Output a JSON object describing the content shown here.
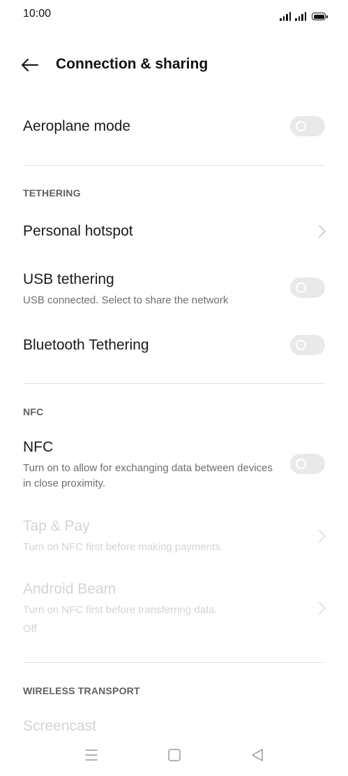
{
  "status_bar": {
    "time": "10:00"
  },
  "header": {
    "title": "Connection & sharing"
  },
  "settings": {
    "aeroplane_mode": {
      "title": "Aeroplane mode",
      "on": false
    },
    "tethering_header": "TETHERING",
    "personal_hotspot": {
      "title": "Personal hotspot"
    },
    "usb_tethering": {
      "title": "USB tethering",
      "subtitle": "USB connected. Select to share the network",
      "on": false
    },
    "bluetooth_tethering": {
      "title": "Bluetooth Tethering",
      "on": false
    },
    "nfc_header": "NFC",
    "nfc": {
      "title": "NFC",
      "subtitle": "Turn on to allow for exchanging data between devices in close proximity.",
      "on": false
    },
    "tap_pay": {
      "title": "Tap & Pay",
      "subtitle": "Turn on NFC first before making payments."
    },
    "android_beam": {
      "title": "Android Beam",
      "subtitle": "Turn on NFC first before transferring data.",
      "status": "Off"
    },
    "wireless_header": "WIRELESS TRANSPORT",
    "screencast": {
      "title": "Screencast"
    }
  },
  "colors": {
    "toggle_off": "#e9e9e9",
    "disabled_text": "#d4d4d4",
    "secondary_text": "#6e6e6e",
    "divider": "#e2e2e2"
  },
  "icons": {
    "back": "arrow-left-icon",
    "chevron": "chevron-right-icon",
    "nav_menu": "menu-icon",
    "nav_home": "home-square-icon",
    "nav_back": "back-triangle-icon"
  }
}
